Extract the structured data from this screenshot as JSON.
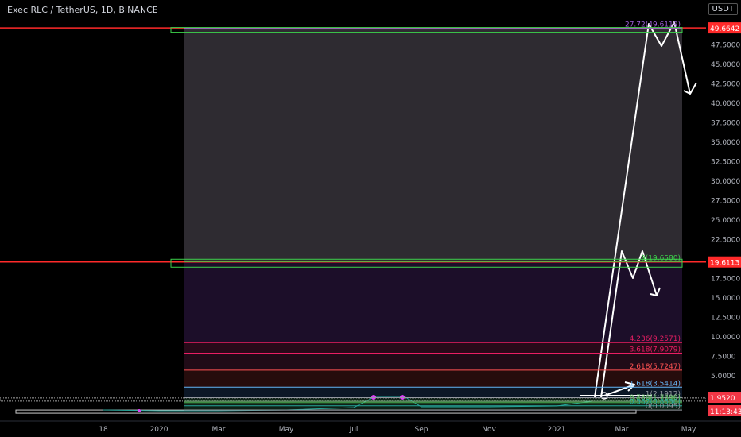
{
  "header": {
    "title": "iExec RLC / TetherUS, 1D, BINANCE",
    "currency": "USDT"
  },
  "chart_data": {
    "type": "line",
    "title": "iExec RLC / TetherUS, 1D, BINANCE",
    "xlabel": "",
    "ylabel": "",
    "ylim": [
      0,
      51
    ],
    "x_ticks": [
      "18",
      "2020",
      "Mar",
      "May",
      "Jul",
      "Sep",
      "Nov",
      "2021",
      "Mar",
      "May"
    ],
    "y_ticks": [
      "47.5000",
      "45.0000",
      "42.5000",
      "40.0000",
      "37.5000",
      "35.0000",
      "32.5000",
      "30.0000",
      "27.5000",
      "25.0000",
      "22.5000",
      "17.5000",
      "15.0000",
      "12.5000",
      "10.0000",
      "7.5000",
      "5.0000"
    ],
    "y_tick_values": [
      47.5,
      45,
      42.5,
      40,
      37.5,
      35,
      32.5,
      30,
      27.5,
      25,
      22.5,
      17.5,
      15,
      12.5,
      10,
      7.5,
      5
    ],
    "horizontal_lines": [
      {
        "value": 49.6642,
        "label": "49.6642",
        "color": "#ff2a2a"
      },
      {
        "value": 19.6113,
        "label": "19.6113",
        "color": "#ff2a2a"
      }
    ],
    "fib_levels": [
      {
        "value": 49.6119,
        "label": "27.72(49.6119)",
        "color": "#9c5fd6"
      },
      {
        "value": 19.658,
        "label": "9(19.6580)",
        "color": "#3cd24b"
      },
      {
        "value": 9.2571,
        "label": "4.236(9.2571)",
        "color": "#e91e63"
      },
      {
        "value": 7.9079,
        "label": "3.618(7.9079)",
        "color": "#e91e63"
      },
      {
        "value": 5.7247,
        "label": "2.618(5.7247)",
        "color": "#ff5252"
      },
      {
        "value": 3.5414,
        "label": "1.618(3.5414)",
        "color": "#64b5f6"
      },
      {
        "value": 2.1912,
        "label": "1(2.1912)",
        "color": "#9598a1"
      },
      {
        "value": 1.72,
        "label": "0.786(1.7290)",
        "color": "#81c784"
      },
      {
        "value": 1.55,
        "label": "0.618(1.3936)",
        "color": "#4caf50"
      },
      {
        "value": 1.15,
        "label": "0.382(0.8530)",
        "color": "#26a69a"
      },
      {
        "value": 0.6,
        "label": "0(0.0095)",
        "color": "#9598a1"
      }
    ],
    "price_labels": [
      {
        "value": 1.952,
        "label": "1.9520",
        "color": "#f23645"
      },
      {
        "value": 0.4,
        "label": "11:13:43",
        "color": "#f23645"
      }
    ],
    "projection_path": [
      {
        "x": "Feb 2021",
        "y": 0.5
      },
      {
        "x": "Apr 2021",
        "y": 49.7
      },
      {
        "x": "Apr 2021",
        "y": 47.7
      },
      {
        "x": "Apr 2021",
        "y": 49.7
      },
      {
        "x": "May 2021",
        "y": 41.0
      },
      {
        "x": "May 2021",
        "y": 42.5
      }
    ]
  }
}
